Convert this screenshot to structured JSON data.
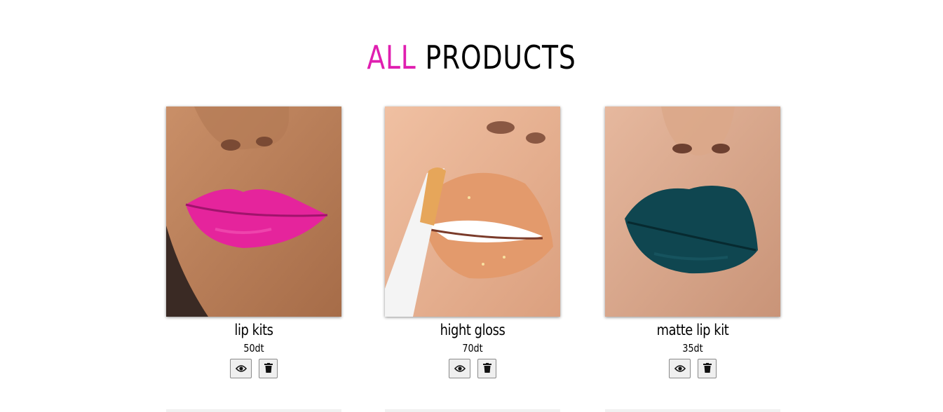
{
  "page": {
    "heading_accent": "ALL",
    "heading_rest": "PRODUCTS",
    "accent_color": "#e01fb0"
  },
  "products": [
    {
      "name": "lip kits",
      "price": "50dt",
      "image": "pink matte lips photo",
      "lip_color": "#e5249c"
    },
    {
      "name": "hight gloss",
      "price": "70dt",
      "image": "glossy nude lips with applicator photo",
      "lip_color": "#e39a6c"
    },
    {
      "name": "matte lip kit",
      "price": "35dt",
      "image": "dark teal matte lips photo",
      "lip_color": "#0f4650"
    }
  ],
  "icons": {
    "view": "eye-icon",
    "delete": "trash-icon"
  }
}
